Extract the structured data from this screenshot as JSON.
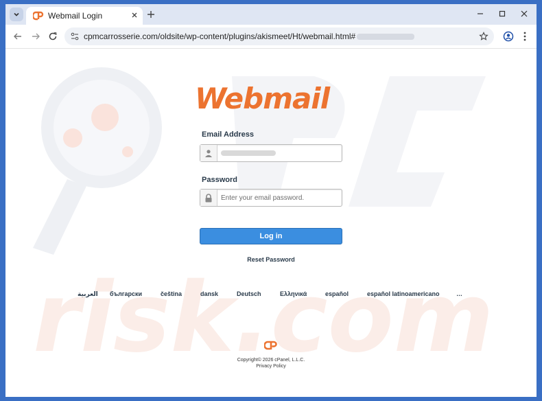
{
  "browser": {
    "tab_title": "Webmail Login",
    "url": "cpmcarrosserie.com/oldsite/wp-content/plugins/akismeet/Ht/webmail.html#"
  },
  "login": {
    "logo_text": "Webmail",
    "email_label": "Email Address",
    "password_label": "Password",
    "password_placeholder": "Enter your email password.",
    "login_button": "Log in",
    "reset_link": "Reset Password"
  },
  "languages": [
    "العربية",
    "български",
    "čeština",
    "dansk",
    "Deutsch",
    "Ελληνικά",
    "español",
    "español latinoamericano",
    "…"
  ],
  "footer": {
    "copyright": "Copyright© 2026 cPanel, L.L.C.",
    "privacy": "Privacy Policy"
  },
  "colors": {
    "brand_orange": "#ec7330",
    "button_blue": "#3b8ee0",
    "frame_blue": "#3a6fc4"
  }
}
